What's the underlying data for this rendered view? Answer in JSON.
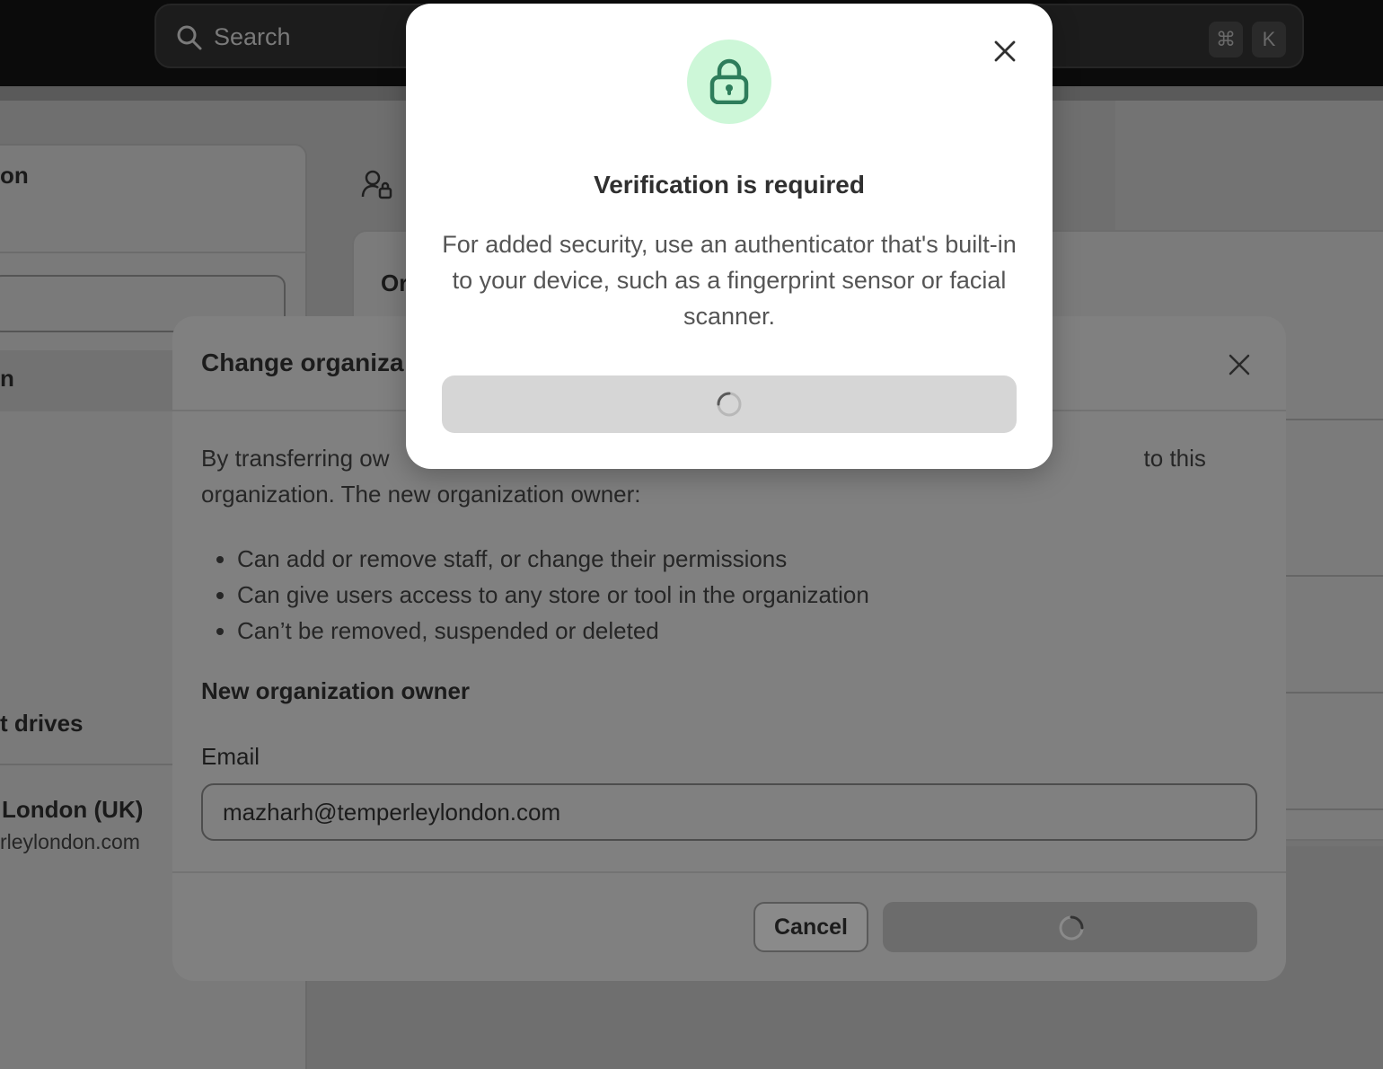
{
  "topbar": {
    "search_placeholder": "Search",
    "shortcut_cmd": "⌘",
    "shortcut_key": "K"
  },
  "background": {
    "sidebar_heading_partial": "on",
    "sidebar_row_partial": "n",
    "drives_partial": "t drives",
    "org_name_partial": "London (UK)",
    "org_domain_partial": "rleylondon.com",
    "card_title_partial": "Or"
  },
  "owner_modal": {
    "title_partial": "Change organiza",
    "intro_start": "By transferring ow",
    "intro_end": "to this",
    "intro_line2": "organization. The new organization owner:",
    "bullets": [
      "Can add or remove staff, or change their permissions",
      "Can give users access to any store or tool in the organization",
      "Can’t be removed, suspended or deleted"
    ],
    "subheading": "New organization owner",
    "email_label": "Email",
    "email_value": "mazharh@temperleylondon.com",
    "cancel_label": "Cancel"
  },
  "verify_modal": {
    "title": "Verification is required",
    "description": "For added security, use an authenticator that's built-in to your device, such as a fingerprint sensor or facial scanner.",
    "accent_color": "#2e7d5b",
    "badge_color": "#cdf7d8"
  }
}
